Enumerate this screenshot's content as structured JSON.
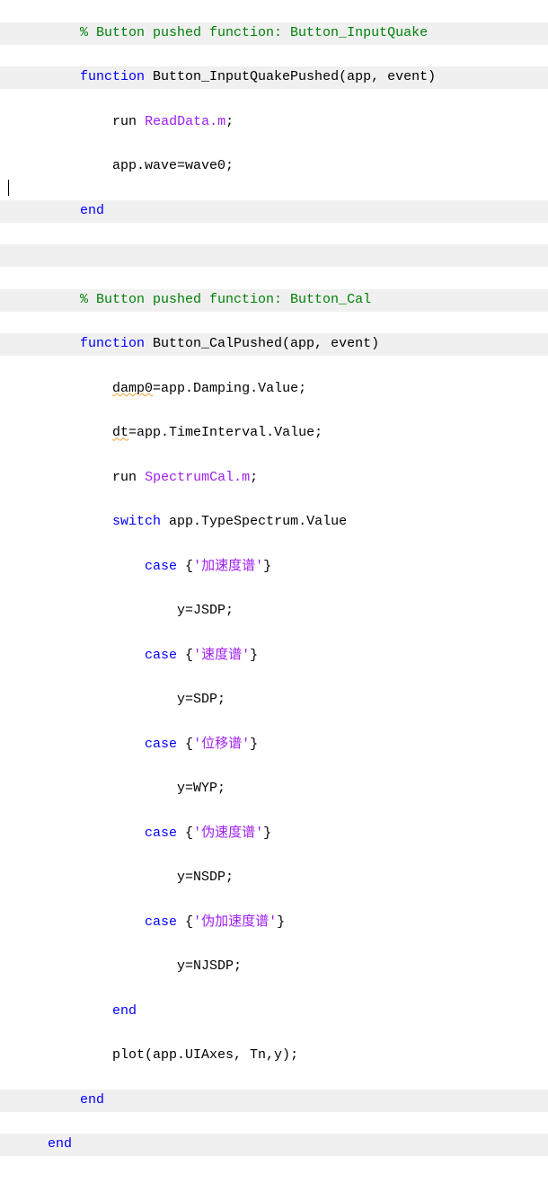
{
  "code": {
    "l1_comment": "% Button pushed function: Button_InputQuake",
    "l2_kw_function": "function",
    "l2_sig": " Button_InputQuakePushed(app, event)",
    "l3_run": "run",
    "l3_file": "ReadData.m",
    "l3_semi": ";",
    "l4": "app.wave=wave0;",
    "l5_end": "end",
    "l7_comment": "% Button pushed function: Button_Cal",
    "l8_kw_function": "function",
    "l8_sig": " Button_CalPushed(app, event)",
    "l9_var": "damp0",
    "l9_rest": "=app.Damping.Value;",
    "l10_var": "dt",
    "l10_rest": "=app.TimeInterval.Value;",
    "l11_run": "run",
    "l11_file": "SpectrumCal.m",
    "l11_semi": ";",
    "l12_switch": "switch",
    "l12_expr": " app.TypeSpectrum.Value",
    "l13_case": "case",
    "l13_brace_open": " {",
    "l13_str": "'加速度谱'",
    "l13_brace_close": "}",
    "l14": "y=JSDP;",
    "l15_case": "case",
    "l15_brace_open": " {",
    "l15_str": "'速度谱'",
    "l15_brace_close": "}",
    "l16": "y=SDP;",
    "l17_case": "case",
    "l17_brace_open": " {",
    "l17_str": "'位移谱'",
    "l17_brace_close": "}",
    "l18": "y=WYP;",
    "l19_case": "case",
    "l19_brace_open": " {",
    "l19_str": "'伪速度谱'",
    "l19_brace_close": "}",
    "l20": "y=NSDP;",
    "l21_case": "case",
    "l21_brace_open": " {",
    "l21_str": "'伪加速度谱'",
    "l21_brace_close": "}",
    "l22": "y=NJSDP;",
    "l23_end": "end",
    "l24": "plot(app.UIAxes, Tn,y);",
    "l25_end": "end",
    "l26_end": "end"
  }
}
